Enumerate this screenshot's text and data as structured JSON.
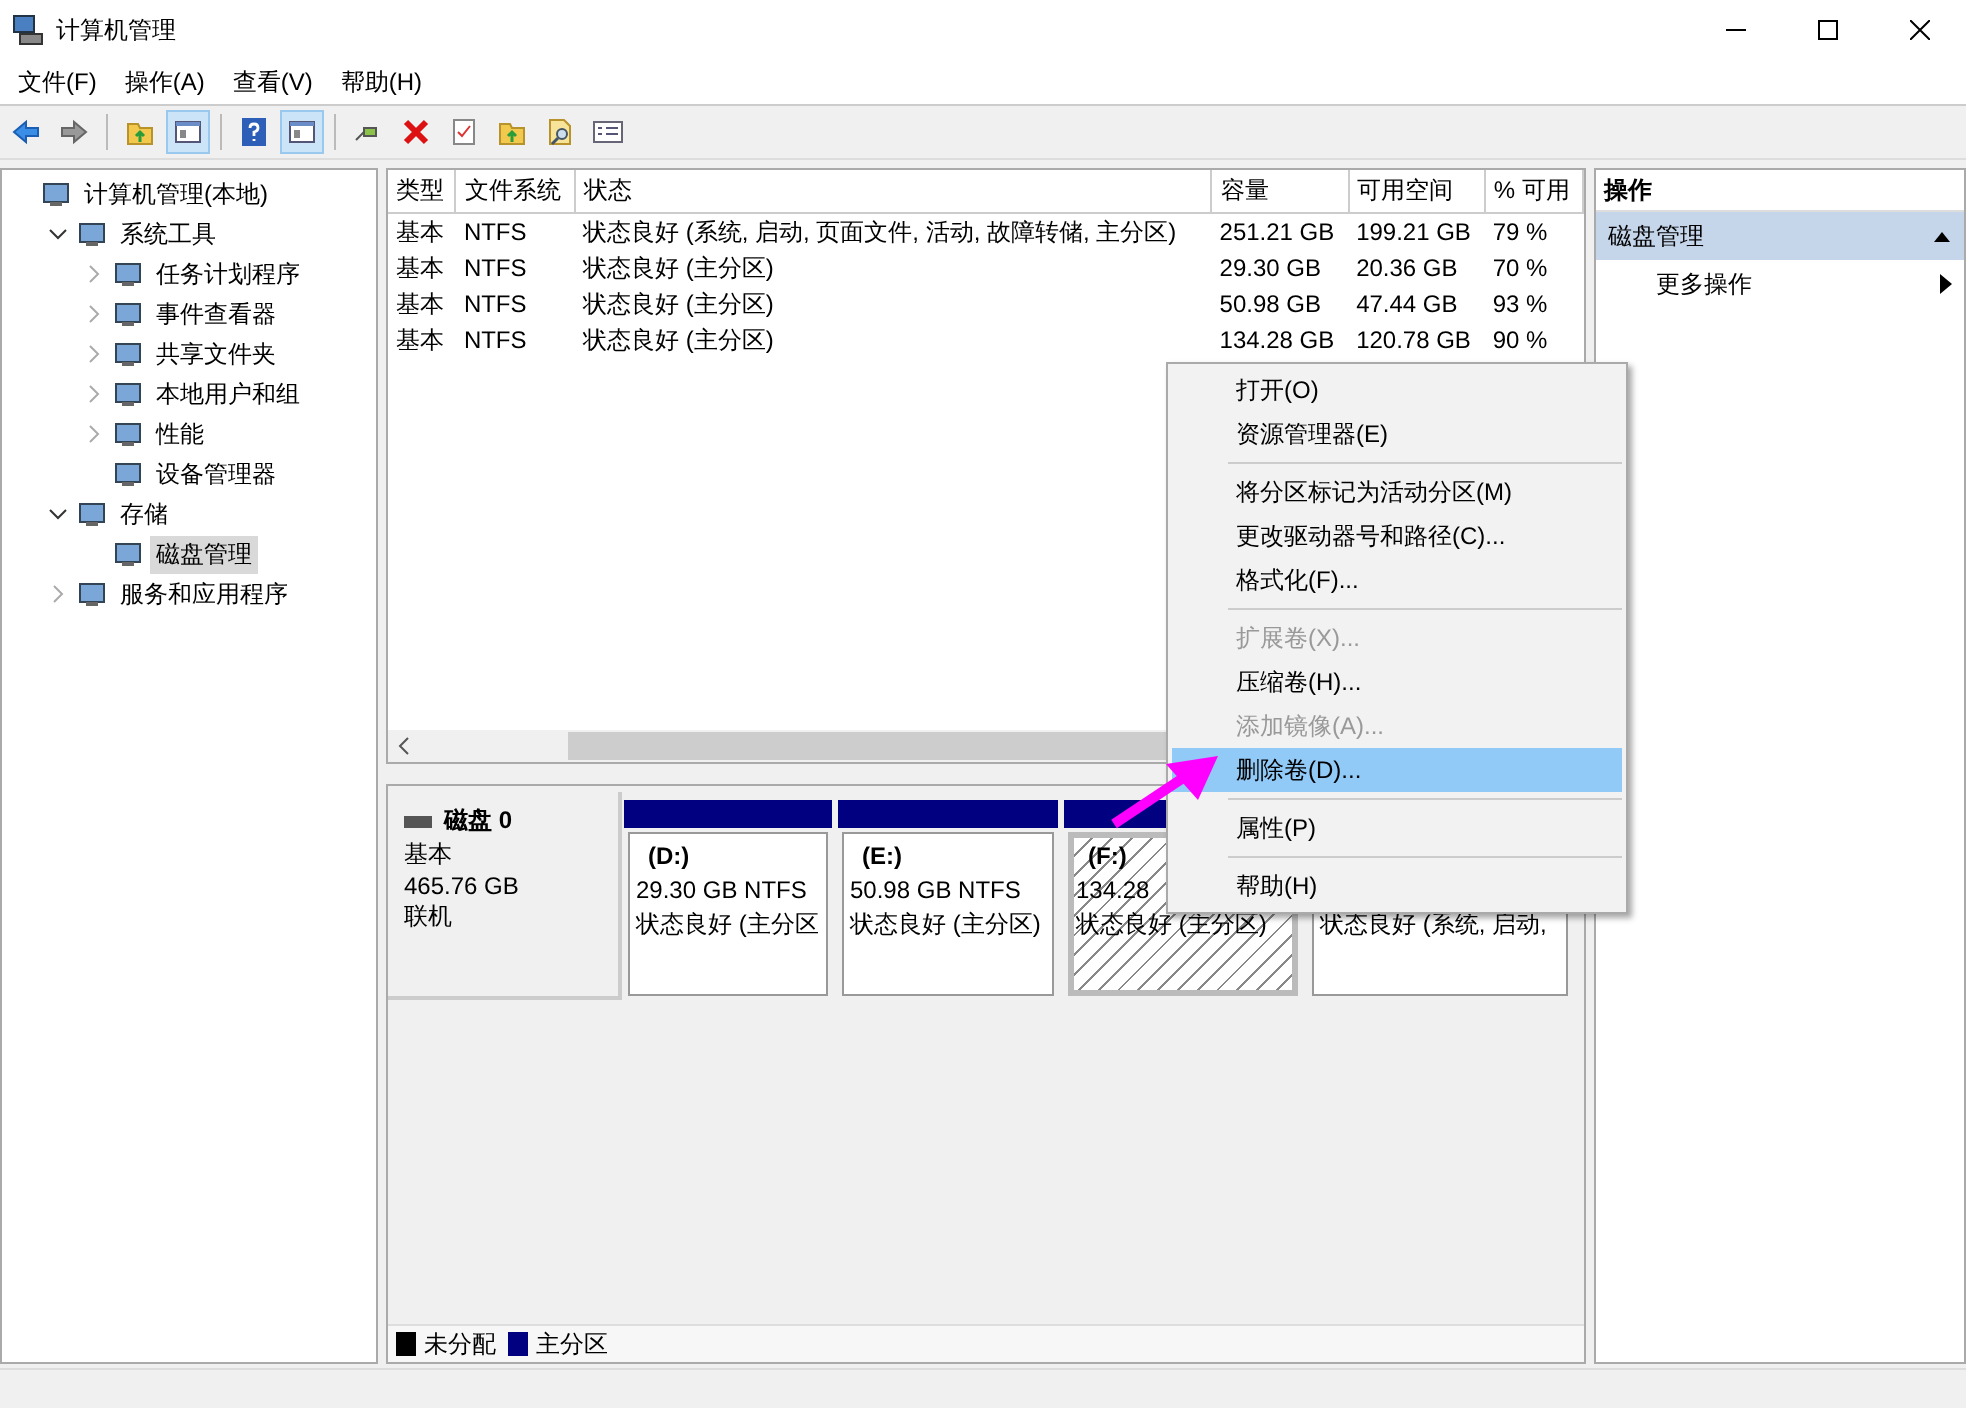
{
  "window": {
    "title": "计算机管理"
  },
  "menu": [
    "文件(F)",
    "操作(A)",
    "查看(V)",
    "帮助(H)"
  ],
  "toolbar": [
    {
      "kind": "back",
      "pressed": false
    },
    {
      "kind": "forward",
      "pressed": false
    },
    {
      "kind": "sep"
    },
    {
      "kind": "folder-up",
      "pressed": false
    },
    {
      "kind": "panel",
      "pressed": true
    },
    {
      "kind": "sep"
    },
    {
      "kind": "help",
      "pressed": false
    },
    {
      "kind": "panel",
      "pressed": true
    },
    {
      "kind": "sep"
    },
    {
      "kind": "plug",
      "pressed": false
    },
    {
      "kind": "delete",
      "pressed": false
    },
    {
      "kind": "check",
      "pressed": false
    },
    {
      "kind": "folder-up",
      "pressed": false
    },
    {
      "kind": "search",
      "pressed": false
    },
    {
      "kind": "list",
      "pressed": false
    }
  ],
  "tree": [
    {
      "label": "计算机管理(本地)",
      "selected": false,
      "children": [
        {
          "label": "系统工具",
          "expanded": true,
          "selected": false,
          "children": [
            {
              "label": "任务计划程序",
              "expanded": false,
              "selected": false
            },
            {
              "label": "事件查看器",
              "expanded": false,
              "selected": false
            },
            {
              "label": "共享文件夹",
              "expanded": false,
              "selected": false
            },
            {
              "label": "本地用户和组",
              "expanded": false,
              "selected": false
            },
            {
              "label": "性能",
              "expanded": false,
              "selected": false
            },
            {
              "label": "设备管理器",
              "selected": false
            }
          ]
        },
        {
          "label": "存储",
          "expanded": true,
          "selected": false,
          "children": [
            {
              "label": "磁盘管理",
              "selected": true
            }
          ]
        },
        {
          "label": "服务和应用程序",
          "expanded": false,
          "selected": false
        }
      ]
    }
  ],
  "table": {
    "columns": [
      "类型",
      "文件系统",
      "状态",
      "容量",
      "可用空间",
      "% 可用"
    ],
    "rows": [
      [
        "基本",
        "NTFS",
        "状态良好 (系统, 启动, 页面文件, 活动, 故障转储, 主分区)",
        "251.21 GB",
        "199.21 GB",
        "79 %"
      ],
      [
        "基本",
        "NTFS",
        "状态良好 (主分区)",
        "29.30 GB",
        "20.36 GB",
        "70 %"
      ],
      [
        "基本",
        "NTFS",
        "状态良好 (主分区)",
        "50.98 GB",
        "47.44 GB",
        "93 %"
      ],
      [
        "基本",
        "NTFS",
        "状态良好 (主分区)",
        "134.28 GB",
        "120.78 GB",
        "90 %"
      ]
    ]
  },
  "disk": {
    "name": "磁盘 0",
    "type": "基本",
    "size": "465.76 GB",
    "status": "联机",
    "partitions": [
      {
        "label": "(D:)",
        "size": "29.30 GB NTFS",
        "status": "状态良好 (主分区",
        "selected": false
      },
      {
        "label": "(E:)",
        "size": "50.98 GB NTFS",
        "status": "状态良好 (主分区)",
        "selected": false
      },
      {
        "label": "(F:)",
        "size": "134.28",
        "status": "状态良好 (主分区)",
        "selected": true
      },
      {
        "status": "状态良好 (系统, 启动,",
        "selected": false
      }
    ]
  },
  "legend": [
    {
      "label": "未分配",
      "color": "#000000"
    },
    {
      "label": "主分区",
      "color": "#000080"
    }
  ],
  "actions": {
    "title": "操作",
    "section": "磁盘管理",
    "expanded": true,
    "items": [
      "更多操作"
    ]
  },
  "context_menu": [
    {
      "kind": "item",
      "label": "打开(O)",
      "disabled": false,
      "selected": false
    },
    {
      "kind": "item",
      "label": "资源管理器(E)",
      "disabled": false,
      "selected": false
    },
    {
      "kind": "separator"
    },
    {
      "kind": "item",
      "label": "将分区标记为活动分区(M)",
      "disabled": false,
      "selected": false
    },
    {
      "kind": "item",
      "label": "更改驱动器号和路径(C)...",
      "disabled": false,
      "selected": false
    },
    {
      "kind": "item",
      "label": "格式化(F)...",
      "disabled": false,
      "selected": false
    },
    {
      "kind": "separator"
    },
    {
      "kind": "item",
      "label": "扩展卷(X)...",
      "disabled": true,
      "selected": false
    },
    {
      "kind": "item",
      "label": "压缩卷(H)...",
      "disabled": false,
      "selected": false
    },
    {
      "kind": "item",
      "label": "添加镜像(A)...",
      "disabled": true,
      "selected": false
    },
    {
      "kind": "item",
      "label": "删除卷(D)...",
      "disabled": false,
      "selected": true
    },
    {
      "kind": "separator"
    },
    {
      "kind": "item",
      "label": "属性(P)",
      "disabled": false,
      "selected": false
    },
    {
      "kind": "separator"
    },
    {
      "kind": "item",
      "label": "帮助(H)",
      "disabled": false,
      "selected": false
    }
  ]
}
